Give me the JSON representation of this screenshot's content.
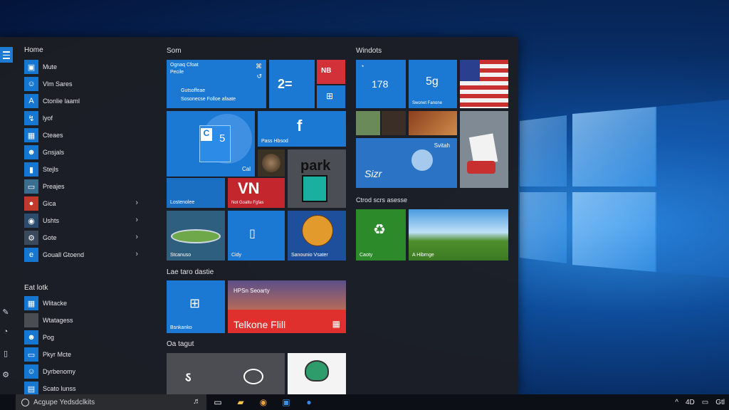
{
  "start_menu": {
    "home_label": "Home",
    "recent_label": "Eat lotk",
    "apps": [
      {
        "label": "Mute",
        "icon": "image-icon",
        "chevron": false
      },
      {
        "label": "Vlm Sares",
        "icon": "people-icon",
        "chevron": false
      },
      {
        "label": "Ctonlie laaml",
        "icon": "clipboard-icon",
        "chevron": false
      },
      {
        "label": "lyof",
        "icon": "bolt-icon",
        "chevron": false
      },
      {
        "label": "Cteaes",
        "icon": "chart-icon",
        "chevron": false
      },
      {
        "label": "Gnsjals",
        "icon": "person-icon",
        "chevron": false
      },
      {
        "label": "Stejls",
        "icon": "bag-icon",
        "chevron": false
      },
      {
        "label": "Preajes",
        "icon": "photo-icon",
        "chevron": false
      },
      {
        "label": "Gica",
        "icon": "game-icon",
        "chevron": true
      },
      {
        "label": "Ushts",
        "icon": "globe-icon",
        "chevron": true
      },
      {
        "label": "Gote",
        "icon": "gear-icon",
        "chevron": true
      },
      {
        "label": "Gouall Gtoend",
        "icon": "edge-icon",
        "chevron": true
      }
    ],
    "recent_apps": [
      {
        "label": "Wlitacke",
        "icon": "grid-icon"
      },
      {
        "label": "Wtatagess",
        "icon": "blank-icon"
      },
      {
        "label": "Pog",
        "icon": "person-icon"
      },
      {
        "label": "Pkyr Mcte",
        "icon": "monitor-icon"
      },
      {
        "label": "Dyrbenomy",
        "icon": "people-icon"
      },
      {
        "label": "Scato lunss",
        "icon": "doc-icon"
      }
    ]
  },
  "groups": {
    "g1": "Som",
    "g2": "Windots",
    "g3": "Lae taro dastie",
    "g4": "Oa tagut",
    "g5": "Ctrod scrs asesse"
  },
  "tiles": {
    "mail_line1": "Ognaq Cfoat",
    "mail_line2": "Pecile",
    "mail_line3": "Gutsoffeae",
    "mail_line4": "Sosonecse Folloe afaate",
    "cal_num": "5",
    "cal_label": "Cal",
    "cal_left_label": "Lostenolee",
    "facebook_label": "Pass Hbsod",
    "weather_num": "178",
    "weather2_num": "5g",
    "weather2_label": "Swonet Fanone",
    "vn_text": "VN",
    "vn_label": "Not Goaltu Fgfas",
    "park_text": "park",
    "sizr_text": "Sizr",
    "sizr_label": "Svitah",
    "stadium_label": "Stcanuso",
    "city_label": "Cidy",
    "basket_label": "Sanounio Vsater",
    "store_label": "Caoty",
    "landscape_label": "A Hibrnge",
    "windows_label": "Bsnkanko",
    "movie_line": "HPSn Seoarty",
    "movie_title": "Telkone Flill"
  },
  "taskbar": {
    "search_text": "Acgupe Yedsdclkits",
    "tray_labels": [
      "4D",
      "Gtl"
    ]
  }
}
